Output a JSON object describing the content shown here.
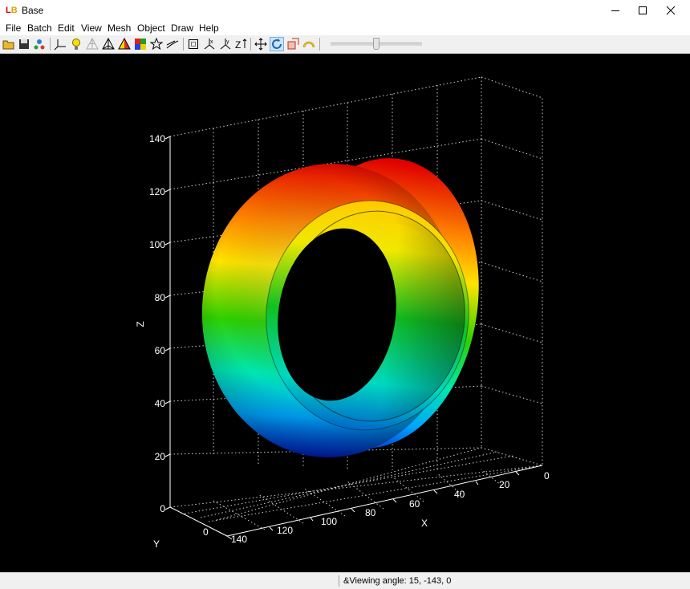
{
  "window": {
    "title": "Base",
    "logo": "LB"
  },
  "menu": [
    "File",
    "Batch",
    "Edit",
    "View",
    "Mesh",
    "Object",
    "Draw",
    "Help"
  ],
  "toolbar": {
    "icons": [
      "open-folder-icon",
      "save-icon",
      "network-icon",
      "axes-icon",
      "light-bulb-icon",
      "wireframe-mesh-icon",
      "solid-mesh-icon",
      "shaded-mesh-icon",
      "color-map-icon",
      "star-icon",
      "contour-lines-icon",
      "bounding-box-icon",
      "axis-x-icon",
      "axis-y-icon",
      "axis-z-icon",
      "pan-icon",
      "rotate-icon",
      "zoom-box-icon",
      "arc-icon"
    ],
    "pressed": "rotate-icon",
    "slider_level": 0.5
  },
  "plot": {
    "z_label": "Z",
    "x_label": "X",
    "y_label": "Y",
    "z_ticks": [
      "140",
      "120",
      "100",
      "80",
      "60",
      "40",
      "20",
      "0"
    ],
    "x_ticks": [
      "0",
      "20",
      "40",
      "60",
      "80",
      "100",
      "120",
      "140"
    ],
    "y_ticks": [
      "0"
    ]
  },
  "status": {
    "text": "&Viewing angle: 15, -143, 0"
  }
}
